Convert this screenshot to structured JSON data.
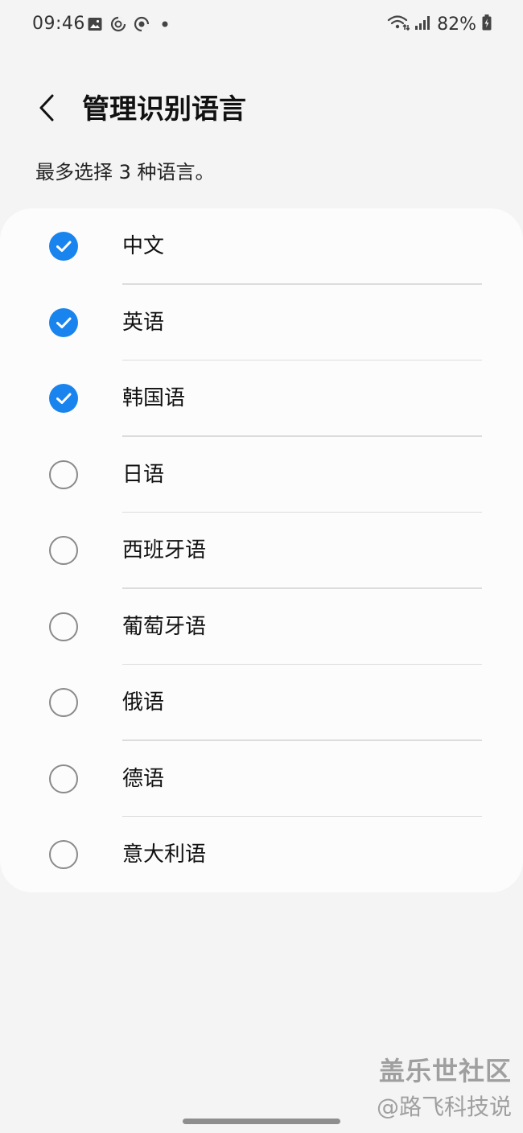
{
  "status_bar": {
    "time": "09:46",
    "battery": "82%",
    "left_icons": [
      "image-icon",
      "sync-icon",
      "sync-icon",
      "dot-icon"
    ],
    "right_icons": [
      "wifi-icon",
      "signal-icon",
      "battery-icon"
    ]
  },
  "header": {
    "title": "管理识别语言",
    "back_icon": "chevron-left-icon"
  },
  "subtitle": "最多选择 3 种语言。",
  "languages": [
    {
      "label": "中文",
      "checked": true
    },
    {
      "label": "英语",
      "checked": true
    },
    {
      "label": "韩国语",
      "checked": true
    },
    {
      "label": "日语",
      "checked": false
    },
    {
      "label": "西班牙语",
      "checked": false
    },
    {
      "label": "葡萄牙语",
      "checked": false
    },
    {
      "label": "俄语",
      "checked": false
    },
    {
      "label": "德语",
      "checked": false
    },
    {
      "label": "意大利语",
      "checked": false
    }
  ],
  "watermark": {
    "line1": "盖乐世社区",
    "line2": "@路飞科技说"
  },
  "colors": {
    "accent": "#1a84ee",
    "background": "#f4f4f4",
    "card": "#fcfcfc",
    "unchecked_border": "#8a8a8a"
  }
}
